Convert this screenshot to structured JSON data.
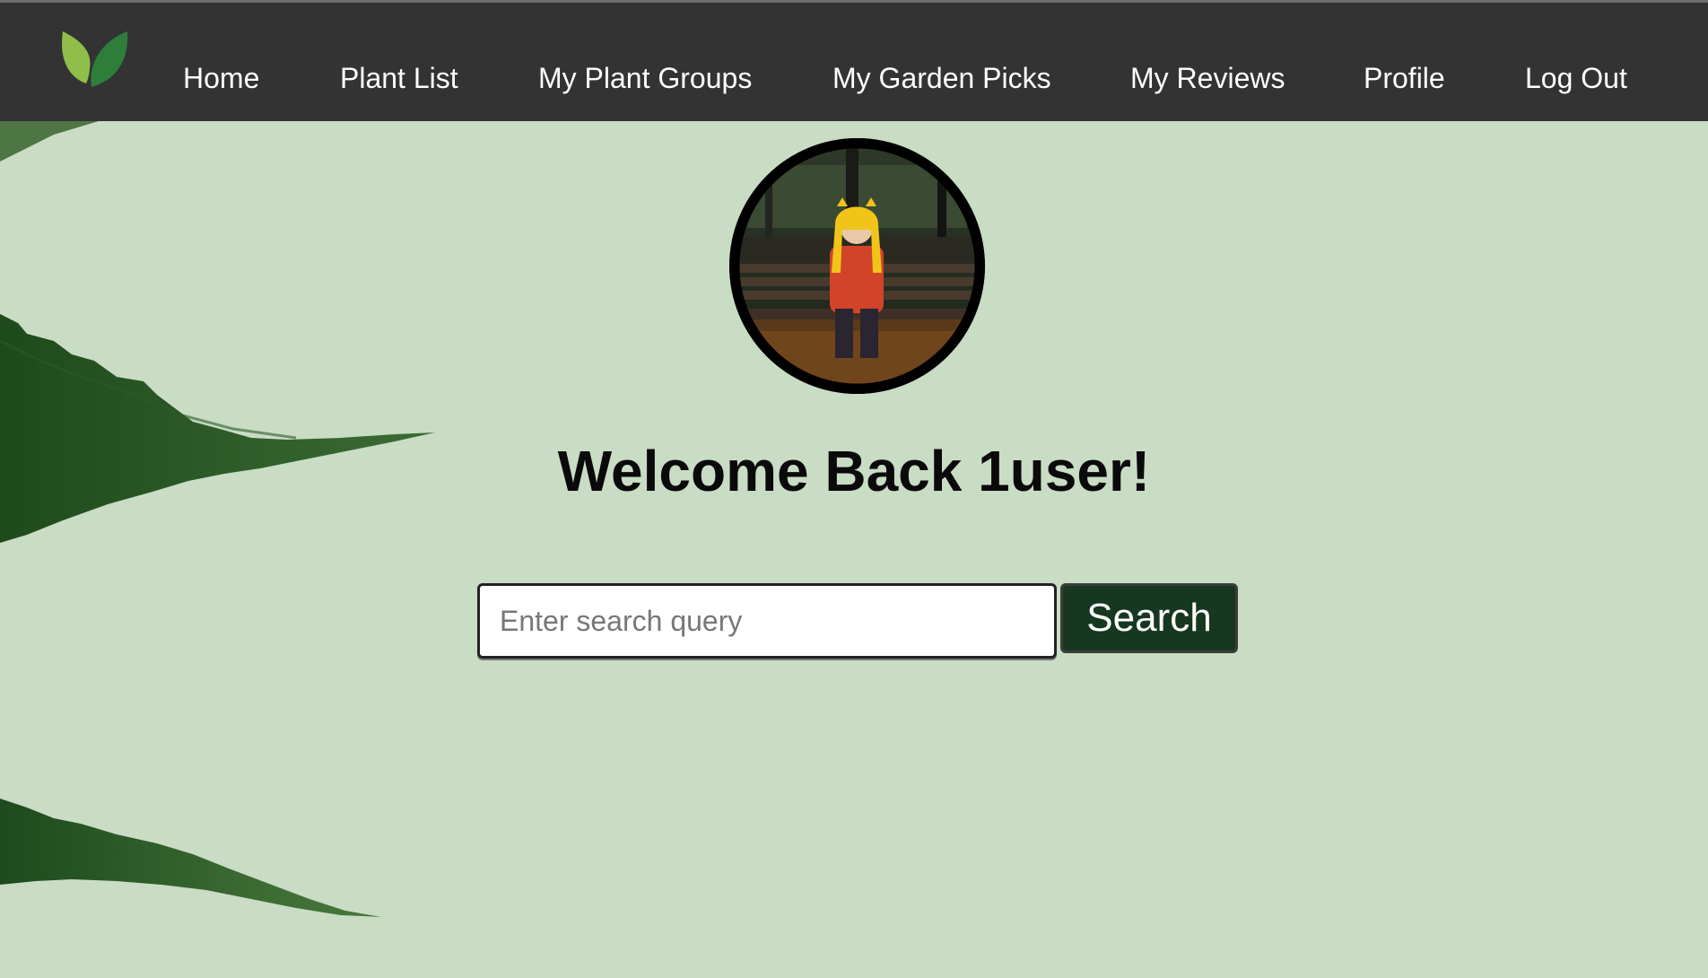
{
  "nav": {
    "logo_icon": "leaf-logo-icon",
    "items": [
      {
        "label": "Home"
      },
      {
        "label": "Plant List"
      },
      {
        "label": "My Plant Groups"
      },
      {
        "label": "My Garden Picks"
      },
      {
        "label": "My Reviews"
      },
      {
        "label": "Profile"
      },
      {
        "label": "Log Out"
      }
    ]
  },
  "main": {
    "welcome": "Welcome Back 1user!",
    "search": {
      "placeholder": "Enter search query",
      "value": "",
      "button_label": "Search"
    }
  },
  "colors": {
    "nav_bg": "#333333",
    "page_bg": "#c9dcc4",
    "search_button": "#173820",
    "logo_light": "#8fbf4a",
    "logo_dark": "#2e7d3a"
  }
}
